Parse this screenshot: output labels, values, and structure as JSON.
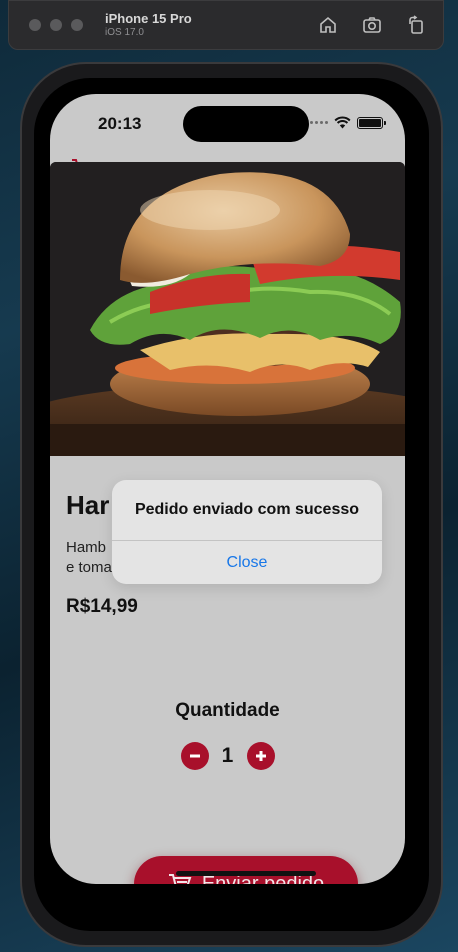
{
  "simulator": {
    "device_name": "iPhone 15 Pro",
    "os_version": "iOS 17.0",
    "tools": [
      "home-icon",
      "screenshot-icon",
      "rotate-icon"
    ]
  },
  "status_bar": {
    "time": "20:13"
  },
  "product": {
    "image_icon": "burger-photo",
    "name_visible": "Har",
    "description_line1": "Hamb",
    "description_line2": "e toma",
    "price": "R$14,99"
  },
  "quantity": {
    "title": "Quantidade",
    "value": "1"
  },
  "send_button": {
    "label": "Enviar pedido",
    "icon": "cart-icon"
  },
  "alert": {
    "title": "Pedido enviado com sucesso",
    "close_label": "Close"
  },
  "colors": {
    "accent": "#a8102b",
    "alert_link": "#1877e8",
    "screen_dim": "#c9c9c9"
  }
}
